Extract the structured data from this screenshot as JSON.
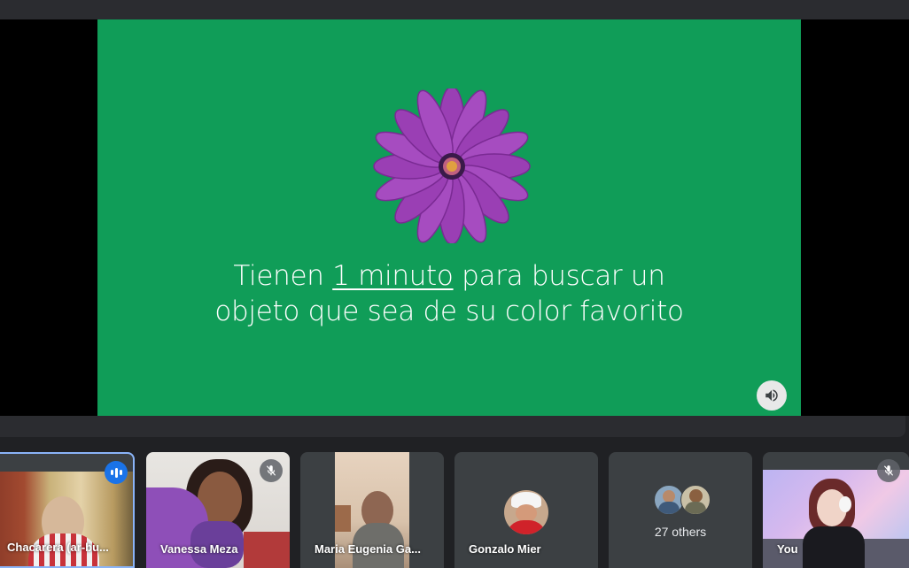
{
  "presentation": {
    "line1_pre": "Tienen ",
    "line1_link": "1 minuto",
    "line1_post": " para buscar un",
    "line2": "objeto que sea de su color favorito",
    "volume_icon": "volume-icon"
  },
  "participants": [
    {
      "name": "Chacarera (ar-bu...",
      "status": "speaking"
    },
    {
      "name": "Vanessa Meza",
      "status": "muted"
    },
    {
      "name": "Maria Eugenia Ga...",
      "status": ""
    },
    {
      "name": "Gonzalo Mier",
      "status": ""
    },
    {
      "others_count_label": "27 others"
    },
    {
      "name": "You",
      "status": "muted"
    }
  ],
  "colors": {
    "slide_green": "#109d58",
    "flower_purple": "#9a3fb4",
    "active_border": "#8ab4f8",
    "speaking_blue": "#1a73e8"
  }
}
